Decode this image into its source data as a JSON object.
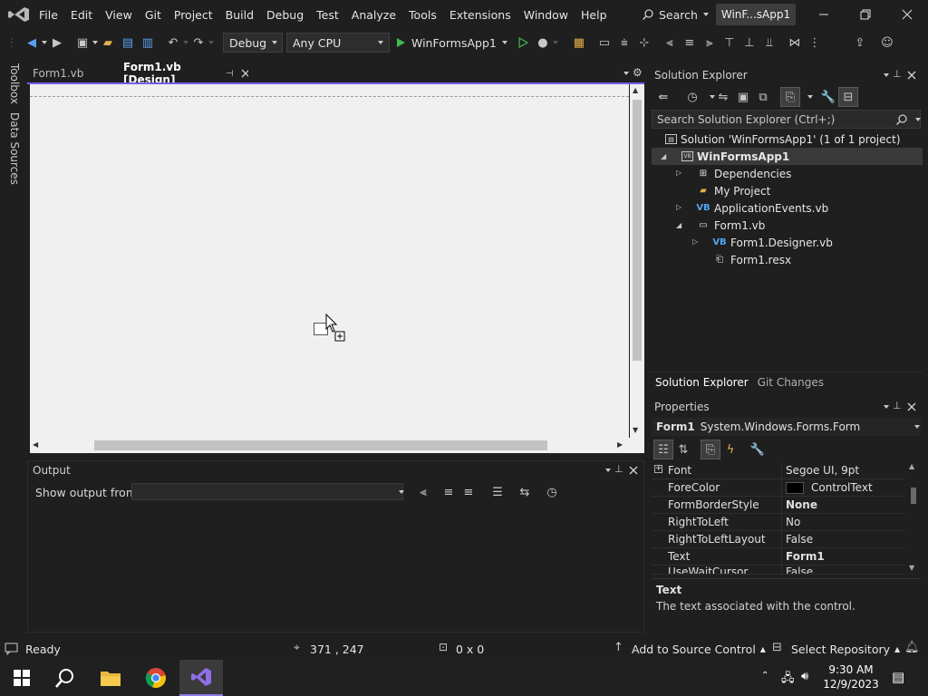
{
  "menubar": {
    "items": [
      "File",
      "Edit",
      "View",
      "Git",
      "Project",
      "Build",
      "Debug",
      "Test",
      "Analyze",
      "Tools",
      "Extensions",
      "Window",
      "Help"
    ],
    "search_label": "Search",
    "solution_badge": "WinF...sApp1"
  },
  "toolbar": {
    "config": "Debug",
    "platform": "Any CPU",
    "start_label": "WinFormsApp1"
  },
  "left_rail": {
    "toolbox": "Toolbox",
    "data_sources": "Data Sources"
  },
  "doc_tabs": {
    "tab1": "Form1.vb",
    "tab2": "Form1.vb [Design]"
  },
  "output": {
    "title": "Output",
    "show_from_label": "Show output from:",
    "show_from_value": ""
  },
  "solution_explorer": {
    "title": "Solution Explorer",
    "search_placeholder": "Search Solution Explorer (Ctrl+;)",
    "solution": "Solution 'WinFormsApp1' (1 of 1 project)",
    "project": "WinFormsApp1",
    "dependencies": "Dependencies",
    "my_project": "My Project",
    "app_events": "ApplicationEvents.vb",
    "form1": "Form1.vb",
    "form1_designer": "Form1.Designer.vb",
    "form1_resx": "Form1.resx",
    "tab_solution": "Solution Explorer",
    "tab_git": "Git Changes",
    "vb_badge": "VB"
  },
  "properties": {
    "title": "Properties",
    "object_name": "Form1",
    "object_type": "System.Windows.Forms.Form",
    "rows": [
      {
        "name": "Font",
        "value": "Segoe UI, 9pt"
      },
      {
        "name": "ForeColor",
        "value": "ControlText"
      },
      {
        "name": "FormBorderStyle",
        "value": "None"
      },
      {
        "name": "RightToLeft",
        "value": "No"
      },
      {
        "name": "RightToLeftLayout",
        "value": "False"
      },
      {
        "name": "Text",
        "value": "Form1"
      },
      {
        "name": "UseWaitCursor",
        "value": "False"
      }
    ],
    "desc_title": "Text",
    "desc_body": "The text associated with the control."
  },
  "statusbar": {
    "ready": "Ready",
    "position": "371 , 247",
    "size": "0 x 0",
    "source_control": "Add to Source Control",
    "repository": "Select Repository"
  },
  "taskbar": {
    "time": "9:30 AM",
    "date": "12/9/2023"
  },
  "colors": {
    "accent": "#7160e8",
    "vb_blue": "#4fa5f0",
    "run_green": "#3fb950"
  }
}
